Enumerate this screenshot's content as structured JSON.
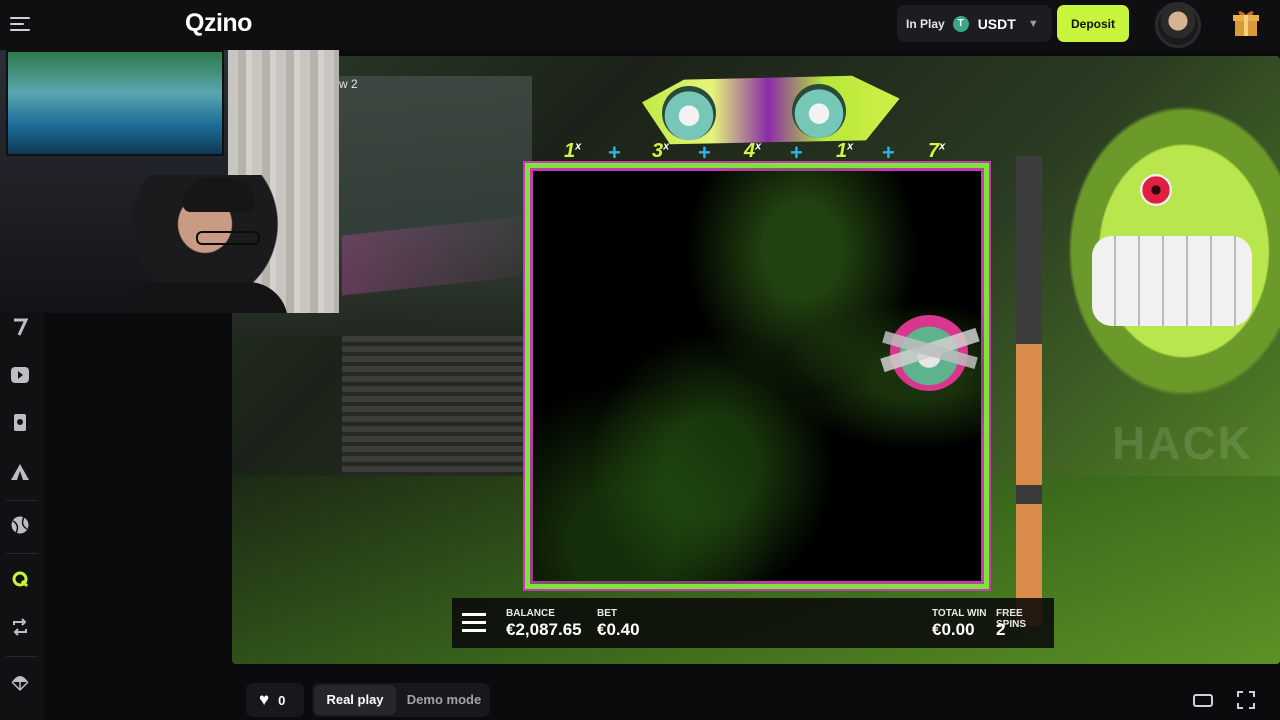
{
  "header": {
    "logo": "Qzino",
    "wallet_status": "In Play",
    "wallet_coin_symbol": "T",
    "wallet_currency": "USDT",
    "deposit_label": "Deposit"
  },
  "sidebar": {
    "icons": [
      "seven-icon",
      "play-icon",
      "cards-icon",
      "tent-icon",
      "basketball-icon",
      "qzino-icon",
      "exchange-icon",
      "parachute-icon"
    ]
  },
  "stream_overlay": {
    "caption_fragment": "w 2"
  },
  "game": {
    "multipliers": [
      "1",
      "3",
      "4",
      "1",
      "7"
    ],
    "multiplier_suffix": "x",
    "watermark": "HACK",
    "balance_label": "BALANCE",
    "balance_value": "€2,087.65",
    "bet_label": "BET",
    "bet_value": "€0.40",
    "total_win_label": "TOTAL WIN",
    "total_win_value": "€0.00",
    "free_spins_label": "FREE SPINS",
    "free_spins_value": "2"
  },
  "footer": {
    "favorites_count": "0",
    "real_play_label": "Real play",
    "demo_mode_label": "Demo mode"
  },
  "colors": {
    "accent": "#c7f53b",
    "frame_green": "#7ee43a",
    "frame_pink": "#c63ab5",
    "plus_blue": "#29b6e6"
  }
}
